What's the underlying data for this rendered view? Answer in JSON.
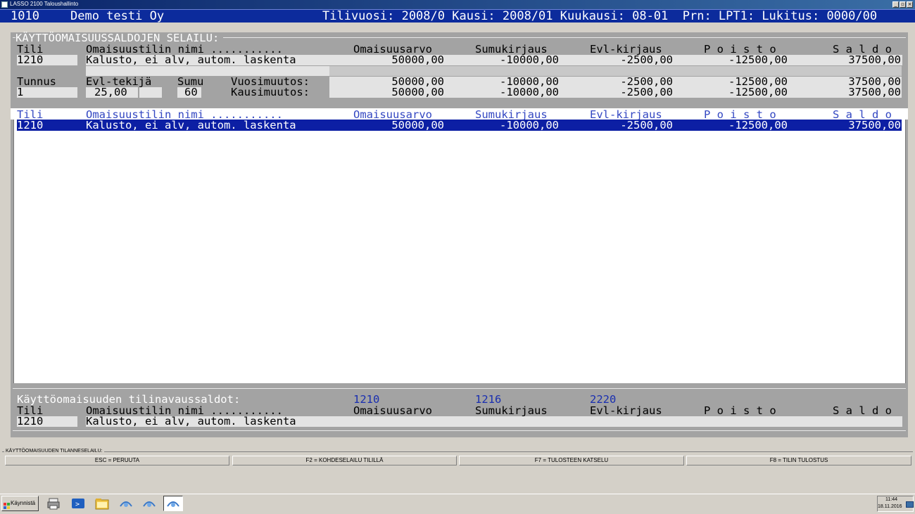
{
  "window": {
    "title": "LASSO 2100 Taloushallinto"
  },
  "header": {
    "company_code": "1010",
    "company_name": "Demo testi Oy",
    "status": "Tilivuosi: 2008/0 Kausi: 2008/01 Kuukausi: 08-01  Prn: LPT1: Lukitus: 0000/00"
  },
  "top": {
    "section_title": "KÄYTTÖOMAISUUSSALDOJEN SELAILU:",
    "headers": [
      "Tili",
      "Omaisuustilin nimi ...........",
      "Omaisuusarvo",
      "Sumukirjaus",
      "Evl-kirjaus",
      "P o i s t o",
      "S a l d o"
    ],
    "row": [
      "1210",
      "Kalusto, ei alv, autom. laskenta",
      "50000,00",
      "-10000,00",
      "-2500,00",
      "-12500,00",
      "37500,00"
    ],
    "tunnus_label": "Tunnus",
    "tunnus_value": "1",
    "evl_label": "Evl-tekijä",
    "evl_value": "25,00",
    "sumu_label": "Sumu",
    "sumu_value": "60",
    "vuosi_label": "Vuosimuutos:",
    "vuosi": [
      "50000,00",
      "-10000,00",
      "-2500,00",
      "-12500,00",
      "37500,00"
    ],
    "kausi_label": "Kausimuutos:",
    "kausi": [
      "50000,00",
      "-10000,00",
      "-2500,00",
      "-12500,00",
      "37500,00"
    ]
  },
  "list": {
    "headers": [
      "Tili",
      "Omaisuustilin nimi ...........",
      "Omaisuusarvo",
      "Sumukirjaus",
      "Evl-kirjaus",
      "P o i s t o",
      "S a l d o"
    ],
    "rows": [
      [
        "1210",
        "Kalusto, ei alv, autom. laskenta",
        "50000,00",
        "-10000,00",
        "-2500,00",
        "-12500,00",
        "37500,00"
      ]
    ]
  },
  "bottom": {
    "title": "Käyttöomaisuuden tilinavaussaldot:",
    "accounts": [
      "1210",
      "1216",
      "2220"
    ],
    "headers": [
      "Tili",
      "Omaisuustilin nimi ...........",
      "Omaisuusarvo",
      "Sumukirjaus",
      "Evl-kirjaus",
      "P o i s t o",
      "S a l d o"
    ],
    "row": [
      "1210",
      "Kalusto, ei alv, autom. laskenta"
    ]
  },
  "function_bar": {
    "title": "KÄYTTÖOMAISUUDEN TILANNESELAILU:",
    "buttons": [
      "ESC = PERUUTA",
      "F2 = KOHDESELAILU TILILLÄ",
      "F7 = TULOSTEEN KATSELU",
      "F8 = TILIN TULOSTUS"
    ]
  },
  "taskbar": {
    "start_label": "Käynnistä",
    "time": "11:44",
    "date": "18.11.2016"
  },
  "colors": {
    "header_bg": "#0c2b9c",
    "panel_gray": "#a3a3a3",
    "selected_row": "#0c1fa4",
    "list_header_text": "#3347c2"
  }
}
